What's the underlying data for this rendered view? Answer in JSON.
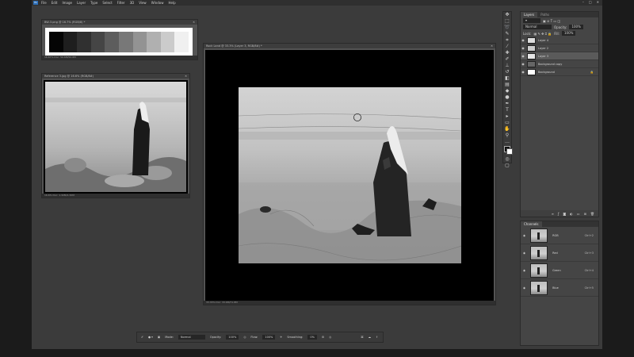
{
  "menu": {
    "logo": "Ps",
    "items": [
      "File",
      "Edit",
      "Image",
      "Layer",
      "Type",
      "Select",
      "Filter",
      "3D",
      "View",
      "Window",
      "Help"
    ],
    "window_controls": [
      "–",
      "□",
      "✕"
    ]
  },
  "docs": {
    "swatch": {
      "title": "BW-3.png @ 16.7% (RGB/8) *",
      "status": "16.67%     Doc: 50.6M/50.6M",
      "colors": [
        "#050505",
        "#1e1e1e",
        "#303030",
        "#454545",
        "#5d5d5d",
        "#787878",
        "#939393",
        "#b0b0b0",
        "#cbcbcb",
        "#f0f0f0"
      ]
    },
    "reference": {
      "title": "Reference 3.jpg @ 16.6% (RGB/8#)",
      "status": "16.6%     Doc: 1.32M/1.32M"
    },
    "main": {
      "title": "Rock Land @ 33.3% (Layer 3, RGB/8#) *",
      "status": "33.33%     Doc: 33.6M/71.8M"
    }
  },
  "layers": {
    "tabs": [
      "Layers",
      "Paths"
    ],
    "blend_mode": "Normal",
    "opacity_label": "Opacity:",
    "opacity_value": "100%",
    "lock_label": "Lock:",
    "fill_label": "Fill:",
    "fill_value": "100%",
    "rows": [
      "Layer 4",
      "Layer 2",
      "Layer 3",
      "Background copy",
      "Background"
    ]
  },
  "channels": {
    "tab": "Channels",
    "rows": [
      {
        "name": "RGB",
        "shortcut": "Ctrl+2"
      },
      {
        "name": "Red",
        "shortcut": "Ctrl+3"
      },
      {
        "name": "Green",
        "shortcut": "Ctrl+4"
      },
      {
        "name": "Blue",
        "shortcut": "Ctrl+5"
      }
    ]
  },
  "options": {
    "mode_label": "Mode:",
    "mode_value": "Normal",
    "opacity_label": "Opacity:",
    "opacity_value": "100%",
    "flow_label": "Flow:",
    "flow_value": "100%",
    "smoothing_label": "Smoothing:",
    "smoothing_value": "0%"
  }
}
